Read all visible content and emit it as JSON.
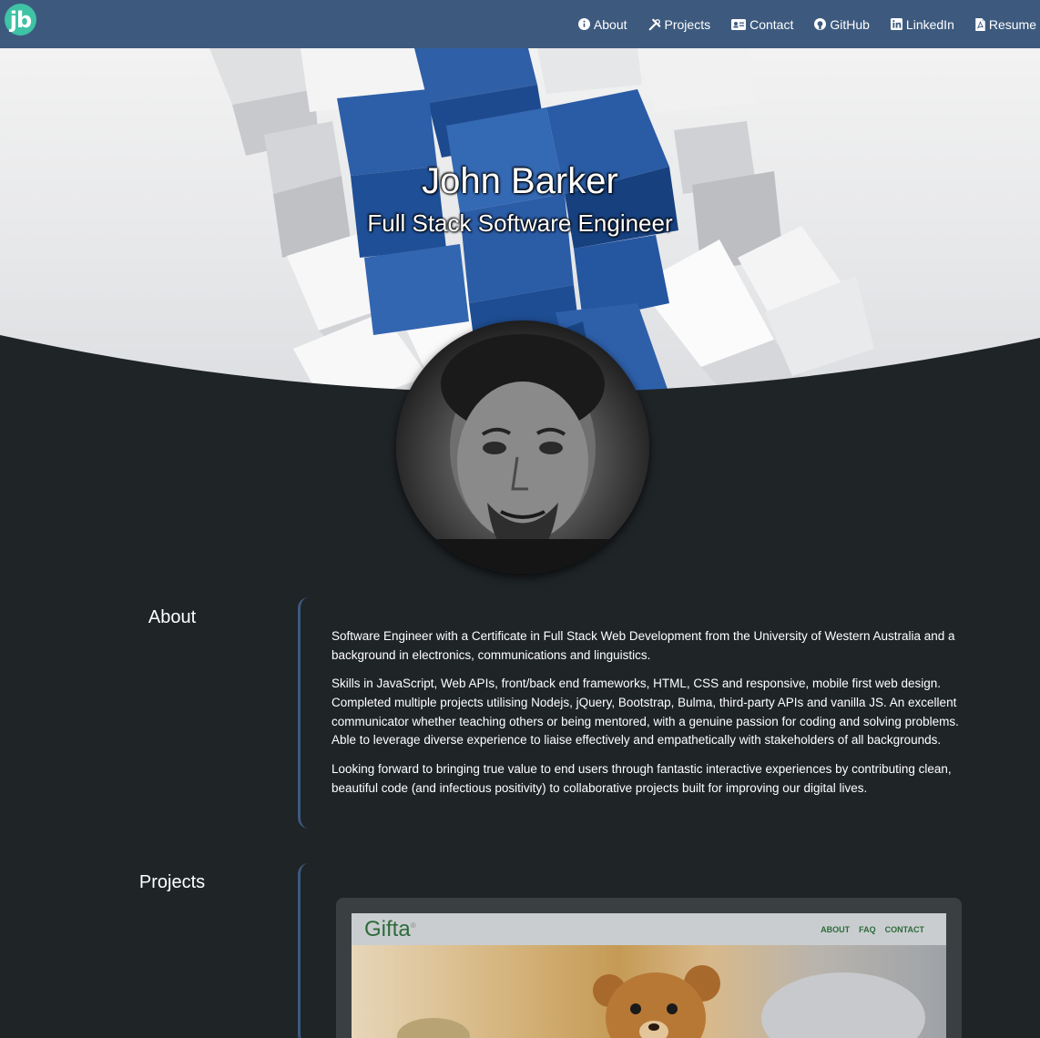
{
  "nav": {
    "logo": "jb",
    "links": [
      {
        "label": "About",
        "icon": "info-circle-icon"
      },
      {
        "label": "Projects",
        "icon": "tools-icon"
      },
      {
        "label": "Contact",
        "icon": "id-card-icon"
      },
      {
        "label": "GitHub",
        "icon": "github-icon"
      },
      {
        "label": "LinkedIn",
        "icon": "linkedin-icon"
      },
      {
        "label": "Resume",
        "icon": "pdf-file-icon"
      }
    ]
  },
  "hero": {
    "name": "John Barker",
    "subtitle": "Full Stack Software Engineer"
  },
  "about": {
    "heading": "About",
    "paragraphs": [
      "Software Engineer with a Certificate in Full Stack Web Development from the University of Western Australia and a background in electronics, communications and linguistics.",
      "Skills in JavaScript, Web APIs, front/back end frameworks, HTML, CSS and responsive, mobile first web design. Completed multiple projects utilising Nodejs, jQuery, Bootstrap, Bulma, third-party APIs and vanilla JS. An excellent communicator whether teaching others or being mentored, with a genuine passion for coding and solving problems. Able to leverage diverse experience to liaise effectively and empathetically with stakeholders of all backgrounds.",
      "Looking forward to bringing true value to end users through fantastic interactive experiences by contributing clean, beautiful code (and infectious positivity) to collaborative projects built for improving our digital lives."
    ]
  },
  "projects": {
    "heading": "Projects",
    "items": [
      {
        "brand": "Gifta",
        "nav": [
          "ABOUT",
          "FAQ",
          "CONTACT"
        ]
      }
    ]
  },
  "colors": {
    "nav_bg": "#3d5a7e",
    "page_bg": "#1f2427",
    "logo_bg": "#3fc2a5",
    "accent": "#3d5a7e"
  }
}
